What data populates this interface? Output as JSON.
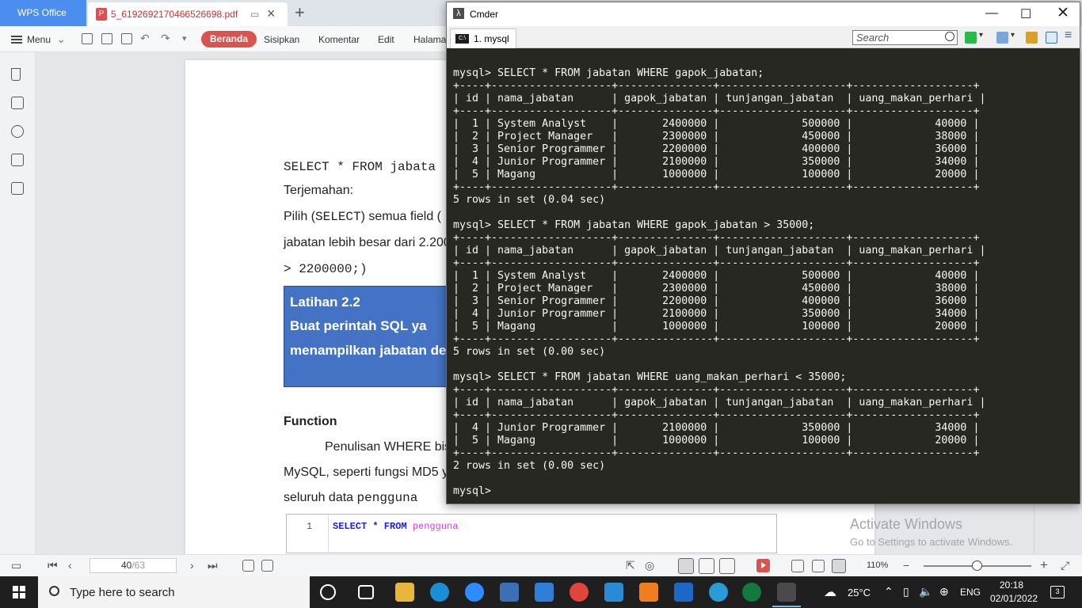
{
  "wps": {
    "home_tab": "WPS Office",
    "doc_tab": "5_6192692170466526698.pdf",
    "menu_label": "Menu",
    "ribbon_tabs": [
      "Beranda",
      "Sisipkan",
      "Komentar",
      "Edit",
      "Halaman"
    ],
    "active_ribbon_tab": "Beranda"
  },
  "document": {
    "query_line": "SELECT * FROM jabata",
    "terjemahan": "Terjemahan:",
    "pilih_prefix": "Pilih (",
    "pilih_select": "SELECT",
    "pilih_suffix": ") semua field (",
    "jabatan_line": "jabatan lebih besar dari 2.200",
    "gt_line": "> 2200000;)",
    "latihan_title": "Latihan 2.2",
    "latihan_line1": "Buat  perintah  SQL  ya",
    "latihan_line2": "menampilkan jabatan de",
    "function_heading": "Function",
    "para_line1": "Penulisan WHERE bis",
    "para_line2": "MySQL, seperti fungsi MD5 y",
    "para_line3_prefix": "seluruh data ",
    "para_line3_code": "pengguna",
    "code_line_no": "1",
    "code_keywords": "SELECT * FROM ",
    "code_table": "pengguna"
  },
  "watermark": {
    "line1": "Activate Windows",
    "line2": "Go to Settings to activate Windows."
  },
  "status_bar": {
    "current_page": "40",
    "total_pages": "/63",
    "zoom": "110%"
  },
  "cmder": {
    "title": "Cmder",
    "tab_label": "1. mysql",
    "search_placeholder": "Search",
    "terminal_text": "mysql> SELECT * FROM jabatan WHERE gapok_jabatan;\n+----+-------------------+---------------+--------------------+-------------------+\n| id | nama_jabatan      | gapok_jabatan | tunjangan_jabatan  | uang_makan_perhari |\n+----+-------------------+---------------+--------------------+-------------------+\n|  1 | System Analyst    |       2400000 |             500000 |             40000 |\n|  2 | Project Manager   |       2300000 |             450000 |             38000 |\n|  3 | Senior Programmer |       2200000 |             400000 |             36000 |\n|  4 | Junior Programmer |       2100000 |             350000 |             34000 |\n|  5 | Magang            |       1000000 |             100000 |             20000 |\n+----+-------------------+---------------+--------------------+-------------------+\n5 rows in set (0.04 sec)\n\nmysql> SELECT * FROM jabatan WHERE gapok_jabatan > 35000;\n+----+-------------------+---------------+--------------------+-------------------+\n| id | nama_jabatan      | gapok_jabatan | tunjangan_jabatan  | uang_makan_perhari |\n+----+-------------------+---------------+--------------------+-------------------+\n|  1 | System Analyst    |       2400000 |             500000 |             40000 |\n|  2 | Project Manager   |       2300000 |             450000 |             38000 |\n|  3 | Senior Programmer |       2200000 |             400000 |             36000 |\n|  4 | Junior Programmer |       2100000 |             350000 |             34000 |\n|  5 | Magang            |       1000000 |             100000 |             20000 |\n+----+-------------------+---------------+--------------------+-------------------+\n5 rows in set (0.00 sec)\n\nmysql> SELECT * FROM jabatan WHERE uang_makan_perhari < 35000;\n+----+-------------------+---------------+--------------------+-------------------+\n| id | nama_jabatan      | gapok_jabatan | tunjangan_jabatan  | uang_makan_perhari |\n+----+-------------------+---------------+--------------------+-------------------+\n|  4 | Junior Programmer |       2100000 |             350000 |             34000 |\n|  5 | Magang            |       1000000 |             100000 |             20000 |\n+----+-------------------+---------------+--------------------+-------------------+\n2 rows in set (0.00 sec)\n\nmysql>"
  },
  "taskbar": {
    "search_placeholder": "Type here to search",
    "weather": "25°C",
    "language": "ENG",
    "time": "20:18",
    "date": "02/01/2022",
    "notification_count": "3"
  },
  "colors": {
    "wps_blue": "#4b8ef0",
    "wps_active_tab": "#d9534f",
    "latihan_fill": "#4472c4",
    "terminal_bg": "#272822"
  }
}
